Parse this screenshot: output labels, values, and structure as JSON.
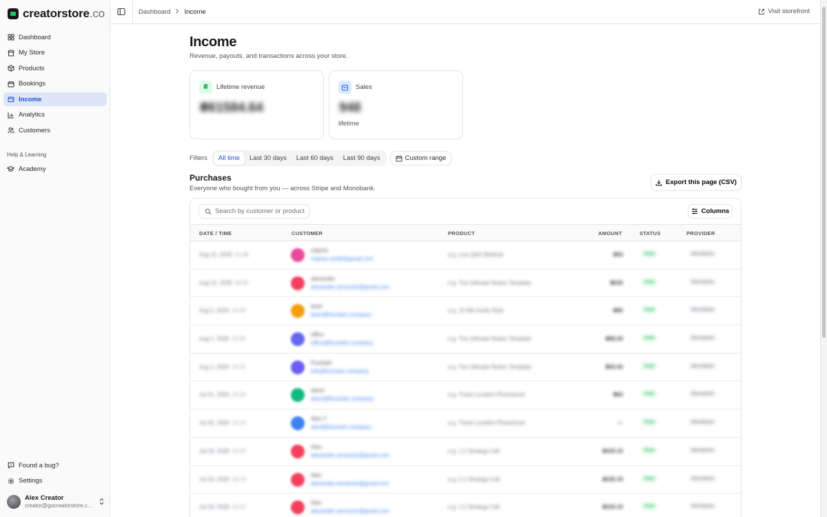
{
  "brand": {
    "name": "creatorstore",
    "tld": ".co"
  },
  "sidebar": {
    "items": [
      {
        "label": "Dashboard",
        "icon": "dashboard-icon"
      },
      {
        "label": "My Store",
        "icon": "store-icon"
      },
      {
        "label": "Products",
        "icon": "package-icon"
      },
      {
        "label": "Bookings",
        "icon": "calendar-icon"
      },
      {
        "label": "Income",
        "icon": "wallet-icon",
        "active": true
      },
      {
        "label": "Analytics",
        "icon": "bar-chart-icon"
      },
      {
        "label": "Customers",
        "icon": "users-icon"
      }
    ],
    "section_label": "Help & Learning",
    "learning": [
      {
        "label": "Academy",
        "icon": "graduation-cap-icon"
      }
    ],
    "bottom": [
      {
        "label": "Found a bug?",
        "icon": "message-alert-icon"
      },
      {
        "label": "Settings",
        "icon": "gear-icon"
      }
    ],
    "user": {
      "name": "Alex Creator",
      "email": "creator@gocreatorstore.c..."
    }
  },
  "topbar": {
    "breadcrumb": [
      "Dashboard",
      "Income"
    ],
    "visit_label": "Visit storefront"
  },
  "page": {
    "title": "Income",
    "subtitle": "Revenue, payouts, and transactions across your store."
  },
  "stats": {
    "revenue": {
      "label": "Lifetime revenue",
      "value": "₴61584.64",
      "badge": "₴"
    },
    "sales": {
      "label": "Sales",
      "value": "948",
      "foot": "lifetime"
    }
  },
  "filters": {
    "label": "Filters",
    "options": [
      "All time",
      "Last 30 days",
      "Last 60 days",
      "Last 90 days"
    ],
    "active": "All time",
    "custom_label": "Custom range"
  },
  "purchases": {
    "title": "Purchases",
    "subtitle": "Everyone who bought from you — across Stripe and Monobank.",
    "export_label": "Export this page (CSV)",
    "search_placeholder": "Search by customer or product",
    "columns_label": "Columns",
    "headers": [
      "DATE / TIME",
      "CUSTOMER",
      "PRODUCT",
      "AMOUNT",
      "STATUS",
      "PROVIDER"
    ],
    "rows": [
      {
        "date": "Aug 15, 2026",
        "time": "21:08",
        "name": "roberto",
        "email": "roberto.smile@gmail.com",
        "product": "e.g. Live Q&A Webinar",
        "amount": "₴50",
        "status": "Paid",
        "provider": "Monobank",
        "color": "#ec4899"
      },
      {
        "date": "Aug 12, 2026",
        "time": "09:50",
        "name": "alexander",
        "email": "alexander.semaush@gmail.com",
        "product": "e.g. The Ultimate Notion Template",
        "amount": "₴530",
        "status": "Paid",
        "provider": "Monobank",
        "color": "#f43f5e"
      },
      {
        "date": "Aug 2, 2026",
        "time": "14:46",
        "name": "lavirt",
        "email": "lavirt@fountain.company",
        "product": "e.g. 10 Min Audio Note",
        "amount": "₴85",
        "status": "Paid",
        "provider": "Monobank",
        "color": "#f59e0b"
      },
      {
        "date": "Aug 1, 2026",
        "time": "13:30",
        "name": "office",
        "email": "office@fountain.company",
        "product": "e.g. The Ultimate Notion Template",
        "amount": "₴88.00",
        "status": "Paid",
        "provider": "Monobank",
        "color": "#6366f1"
      },
      {
        "date": "Aug 1, 2026",
        "time": "10:15",
        "name": "Fountain",
        "email": "info@fountain.company",
        "product": "e.g. The Ultimate Notion Template",
        "amount": "₴50.00",
        "status": "Paid",
        "provider": "Monobank",
        "color": "#6d5cf6"
      },
      {
        "date": "Jul 31, 2026",
        "time": "22:22",
        "name": "alexrt",
        "email": "alexrt@fountain.company",
        "product": "e.g. Three Location Photoshoot",
        "amount": "₴60",
        "status": "Paid",
        "provider": "Monobank",
        "color": "#10b981"
      },
      {
        "date": "Jul 25, 2026",
        "time": "12:14",
        "name": "Alex Y",
        "email": "alexf@fountain.company",
        "product": "e.g. Three Location Photoshoot",
        "amount": "—",
        "status": "Paid",
        "provider": "Monobank",
        "color": "#3b82f6"
      },
      {
        "date": "Jul 24, 2026",
        "time": "10:13",
        "name": "Alex",
        "email": "alexander.semaush@gmail.com",
        "product": "e.g. 1:1 Strategy Call",
        "amount": "₴335.33",
        "status": "Paid",
        "provider": "Monobank",
        "color": "#f43f5e"
      },
      {
        "date": "Jul 24, 2026",
        "time": "10:13",
        "name": "Alex",
        "email": "alexander.semaush@gmail.com",
        "product": "e.g. 1:1 Strategy Call",
        "amount": "₴335.33",
        "status": "Paid",
        "provider": "Monobank",
        "color": "#f43f5e"
      },
      {
        "date": "Jul 24, 2026",
        "time": "10:12",
        "name": "Alex",
        "email": "alexander.semaush@gmail.com",
        "product": "e.g. 1:1 Strategy Call",
        "amount": "₴335.33",
        "status": "Paid",
        "provider": "Monobank",
        "color": "#f43f5e"
      }
    ]
  }
}
